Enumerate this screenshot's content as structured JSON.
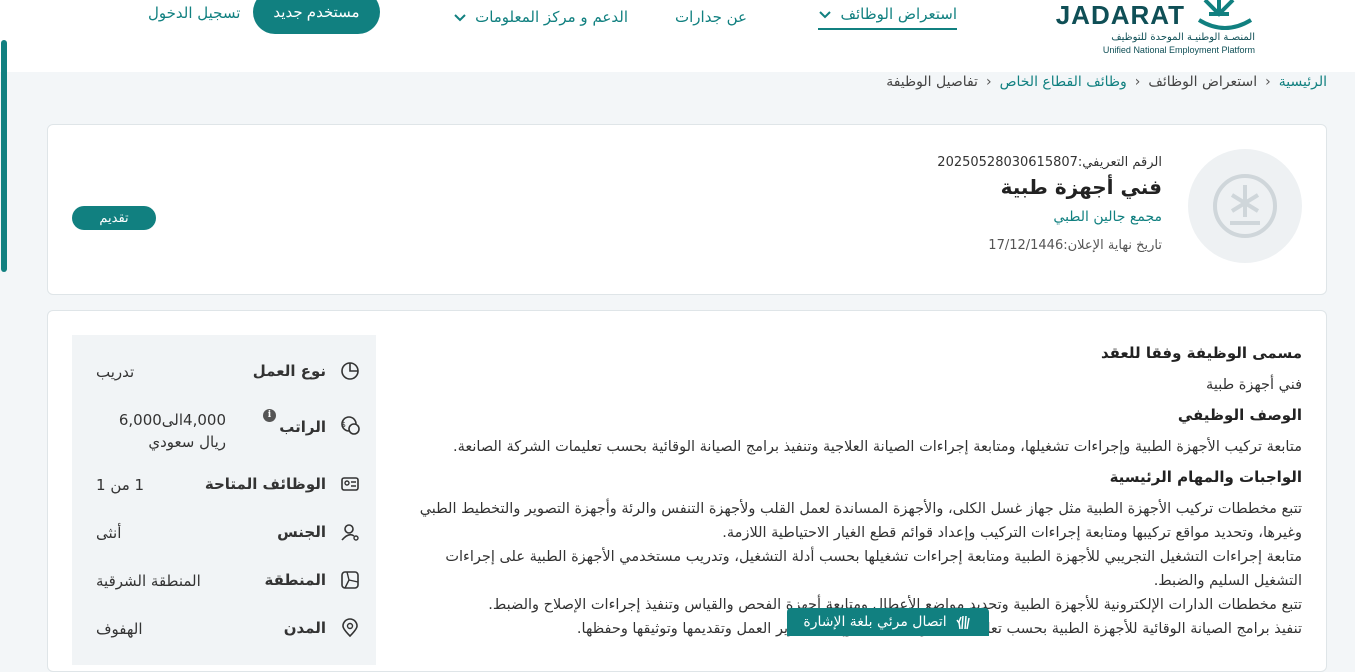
{
  "header": {
    "logo": {
      "wordmark": "JADARAT",
      "arabic_tagline": "المنصـة الوطنيـة الموحدة للتوظيف",
      "english_tagline": "Unified National Employment Platform"
    },
    "nav": {
      "browse_jobs": "استعراض الوظائف",
      "about": "عن جدارات",
      "support": "الدعم و مركز المعلومات"
    },
    "new_user_button": "مستخدم جديد",
    "login_link": "تسجيل الدخول"
  },
  "breadcrumb": {
    "home": "الرئيسية",
    "browse_jobs": "استعراض الوظائف",
    "private_sector": "وظائف القطاع الخاص",
    "current": "تفاصيل الوظيفة"
  },
  "job": {
    "id_line": "الرقم التعريفي:20250528030615807",
    "title": "فني أجهزة طبية",
    "company": "مجمع جالين الطبي",
    "deadline_line": "تاريخ نهاية الإعلان:17/12/1446",
    "apply_button": "تقديم"
  },
  "details": {
    "contract_title_heading": "مسمى الوظيفة وفقا للعقد",
    "contract_title_value": "فني أجهزة طبية",
    "description_heading": "الوصف الوظيفي",
    "description_text": "متابعة تركيب الأجهزة الطبية وإجراءات تشغيلها، ومتابعة إجراءات الصيانة العلاجية وتنفيذ برامج الصيانة الوقائية بحسب تعليمات الشركة الصانعة.",
    "duties_heading": "الواجبات والمهام الرئيسية",
    "duties": [
      "تتبع مخططات تركيب الأجهزة الطبية مثل جهاز غسل الكلى، والأجهزة المساندة لعمل القلب ولأجهزة التنفس والرئة وأجهزة التصوير والتخطيط الطبي وغيرها، وتحديد مواقع تركيبها ومتابعة إجراءات التركيب وإعداد قوائم قطع الغيار الاحتياطية اللازمة.",
      "متابعة إجراءات التشغيل التجريبي للأجهزة الطبية ومتابعة إجراءات تشغيلها بحسب أدلة التشغيل، وتدريب مستخدمي الأجهزة الطبية على إجراءات التشغيل السليم والضبط.",
      "تتبع مخططات الدارات الإلكترونية للأجهزة الطبية وتحديد مواضع الأعطال ومتابعة أجهزة الفحص والقياس وتنفيذ إجراءات الإصلاح والضبط.",
      "تنفيذ برامج الصيانة الوقائية للأجهزة الطبية بحسب تعليمات الشركة الصانعة وإعداد تقارير العمل وتقديمها وتوثيقها وحفظها."
    ]
  },
  "sidebar": {
    "work_type": {
      "label": "نوع العمل",
      "value": "تدريب"
    },
    "salary": {
      "label": "الراتب",
      "value": "4,000الى6,000 ريال سعودي"
    },
    "vacancies": {
      "label": "الوظائف المتاحة",
      "value": "1 من 1"
    },
    "gender": {
      "label": "الجنس",
      "value": "أنثى"
    },
    "region": {
      "label": "المنطقة",
      "value": "المنطقة الشرقية"
    },
    "city": {
      "label": "المدن",
      "value": "الهفوف"
    }
  },
  "sign_language": {
    "label": "اتصال مرئي بلغة الإشارة"
  },
  "colors": {
    "primary": "#118080",
    "background": "#f3f6f8",
    "panel": "#f1f4f6"
  }
}
